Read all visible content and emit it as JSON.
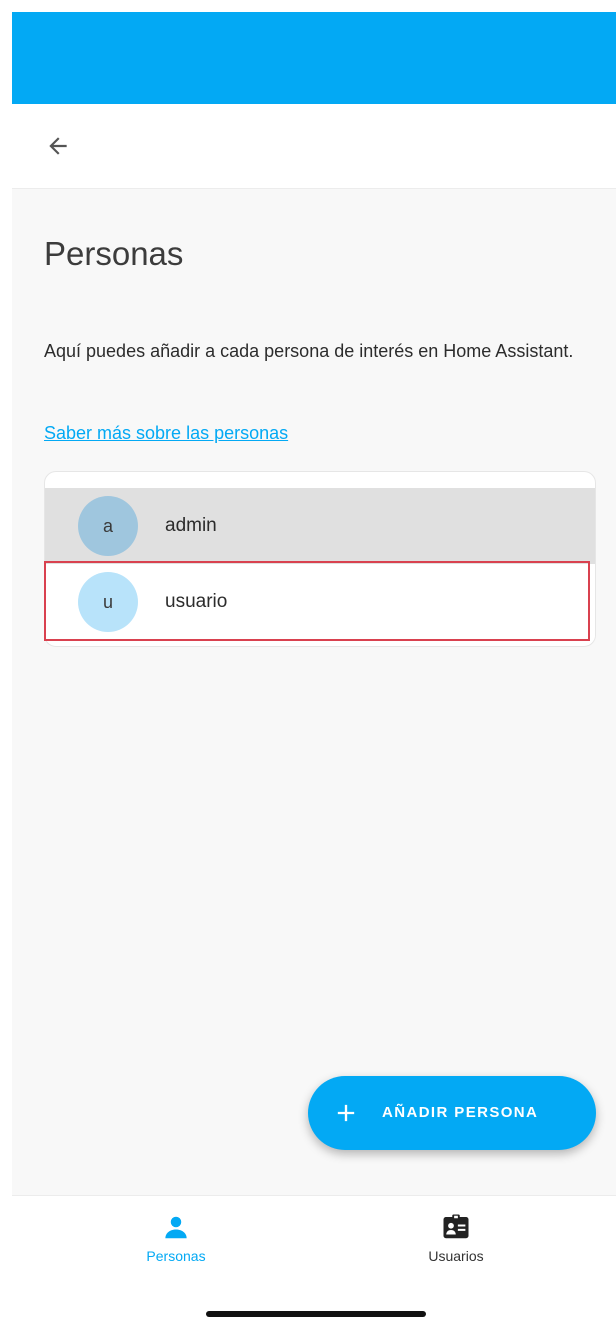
{
  "colors": {
    "primary": "#03a9f4",
    "selected_row": "#e0e0e0",
    "highlight_border": "#d9414f",
    "avatar_admin": "#9fc6de",
    "avatar_usuario": "#b8e3fa"
  },
  "toolbar": {
    "back_icon": "arrow-left-icon"
  },
  "page": {
    "title": "Personas",
    "description": "Aquí puedes añadir a cada persona de interés en Home Assistant.",
    "learn_more": "Saber más sobre las personas"
  },
  "persons": [
    {
      "initial": "a",
      "name": "admin",
      "selected": true
    },
    {
      "initial": "u",
      "name": "usuario",
      "selected": false
    }
  ],
  "fab": {
    "icon": "plus-icon",
    "label": "AÑADIR PERSONA"
  },
  "bottom_nav": {
    "tabs": [
      {
        "label": "Personas",
        "icon": "person-icon",
        "active": true
      },
      {
        "label": "Usuarios",
        "icon": "user-badge-icon",
        "active": false
      }
    ]
  }
}
